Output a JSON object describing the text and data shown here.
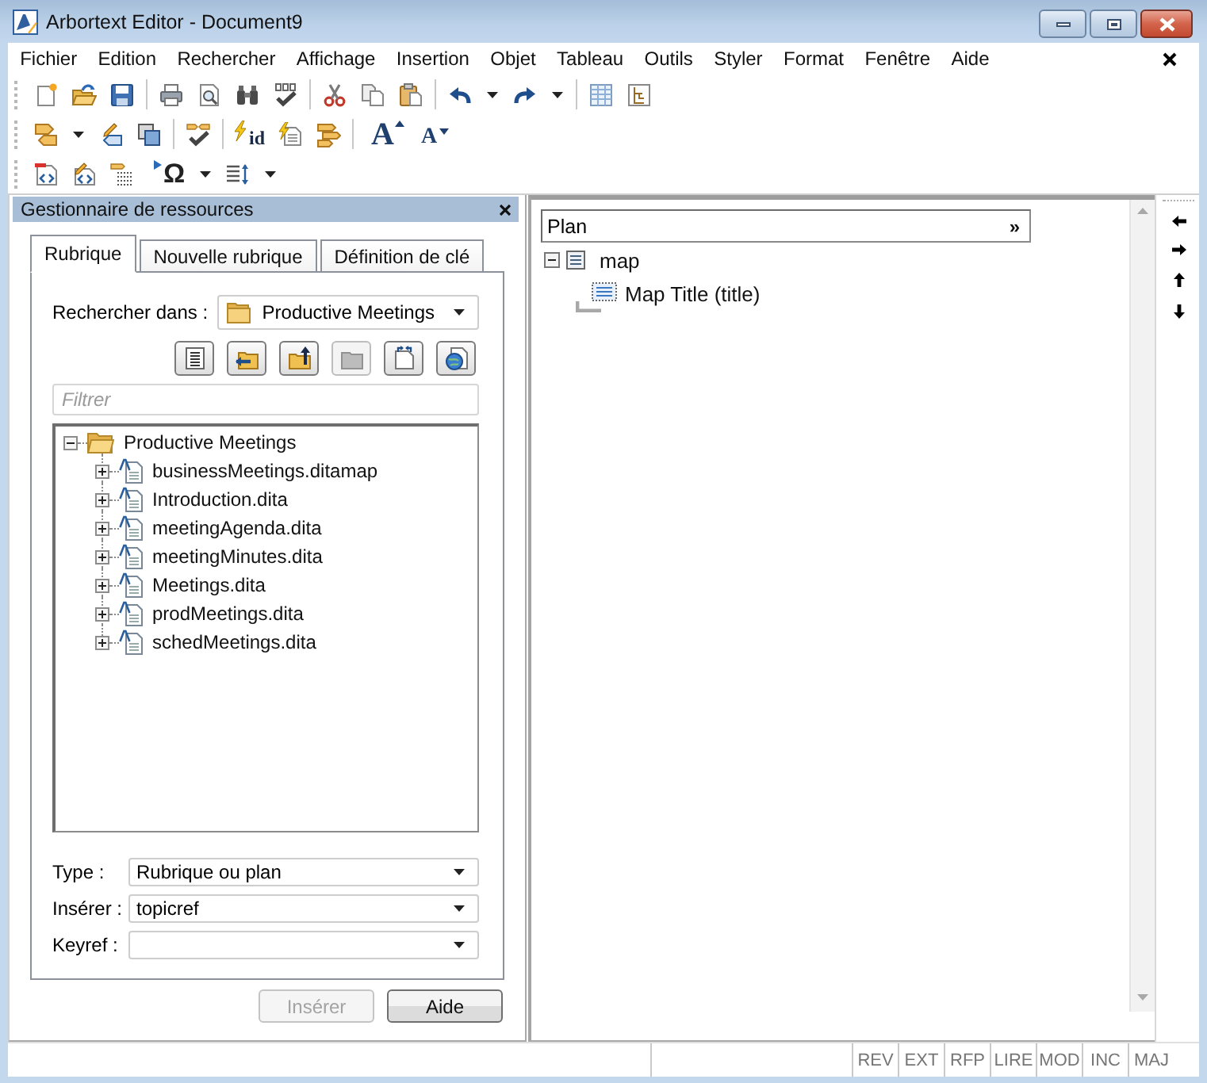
{
  "window": {
    "title": "Arbortext Editor - Document9"
  },
  "menu": [
    "Fichier",
    "Edition",
    "Rechercher",
    "Affichage",
    "Insertion",
    "Objet",
    "Tableau",
    "Outils",
    "Styler",
    "Format",
    "Fenêtre",
    "Aide"
  ],
  "toolbar": {
    "id_button": "id",
    "font_buttons": [
      {
        "label": "A",
        "kind": "grow"
      },
      {
        "label": "A",
        "kind": "shrink"
      }
    ],
    "symbol_button": "Ω"
  },
  "resource_panel": {
    "title": "Gestionnaire de ressources",
    "tabs": [
      {
        "label": "Rubrique",
        "selected": true
      },
      {
        "label": "Nouvelle rubrique",
        "selected": false
      },
      {
        "label": "Définition de clé",
        "selected": false
      }
    ],
    "search_in": {
      "label": "Rechercher dans :",
      "value": "Productive Meetings"
    },
    "actions": [
      {
        "kind": "list",
        "disabled": false
      },
      {
        "kind": "back",
        "disabled": false
      },
      {
        "kind": "up",
        "disabled": false
      },
      {
        "kind": "folder",
        "disabled": true
      },
      {
        "kind": "refresh",
        "disabled": false
      },
      {
        "kind": "web",
        "disabled": false
      }
    ],
    "filter": {
      "placeholder": "Filtrer"
    },
    "tree": [
      {
        "label": "Productive Meetings",
        "kind": "folder",
        "expanded": true,
        "children": [
          {
            "label": "businessMeetings.ditamap",
            "kind": "file",
            "expanded": false
          },
          {
            "label": "Introduction.dita",
            "kind": "file",
            "expanded": false
          },
          {
            "label": "meetingAgenda.dita",
            "kind": "file",
            "expanded": false
          },
          {
            "label": "meetingMinutes.dita",
            "kind": "file",
            "expanded": false
          },
          {
            "label": "Meetings.dita",
            "kind": "file",
            "expanded": false
          },
          {
            "label": "prodMeetings.dita",
            "kind": "file",
            "expanded": false
          },
          {
            "label": "schedMeetings.dita",
            "kind": "file",
            "expanded": false
          }
        ]
      }
    ],
    "fields": [
      {
        "label": "Type :",
        "value": "Rubrique ou plan"
      },
      {
        "label": "Insérer :",
        "value": "topicref"
      },
      {
        "label": "Keyref :"
      }
    ],
    "buttons": [
      {
        "label": "Insérer",
        "disabled": true
      },
      {
        "label": "Aide",
        "disabled": false
      }
    ]
  },
  "outline": {
    "title": "Plan",
    "more": "»",
    "tree": [
      {
        "label": "map",
        "expanded": true,
        "children": [
          {
            "label": "Map Title (title)"
          }
        ]
      }
    ]
  },
  "status_bar": [
    {
      "label": "REV",
      "active": false
    },
    {
      "label": "EXT",
      "active": false
    },
    {
      "label": "RFP",
      "active": false
    },
    {
      "label": "LIRE",
      "active": false
    },
    {
      "label": "MOD",
      "active": false
    },
    {
      "label": "INC",
      "active": false
    },
    {
      "label": "MAJ",
      "active": false
    }
  ]
}
